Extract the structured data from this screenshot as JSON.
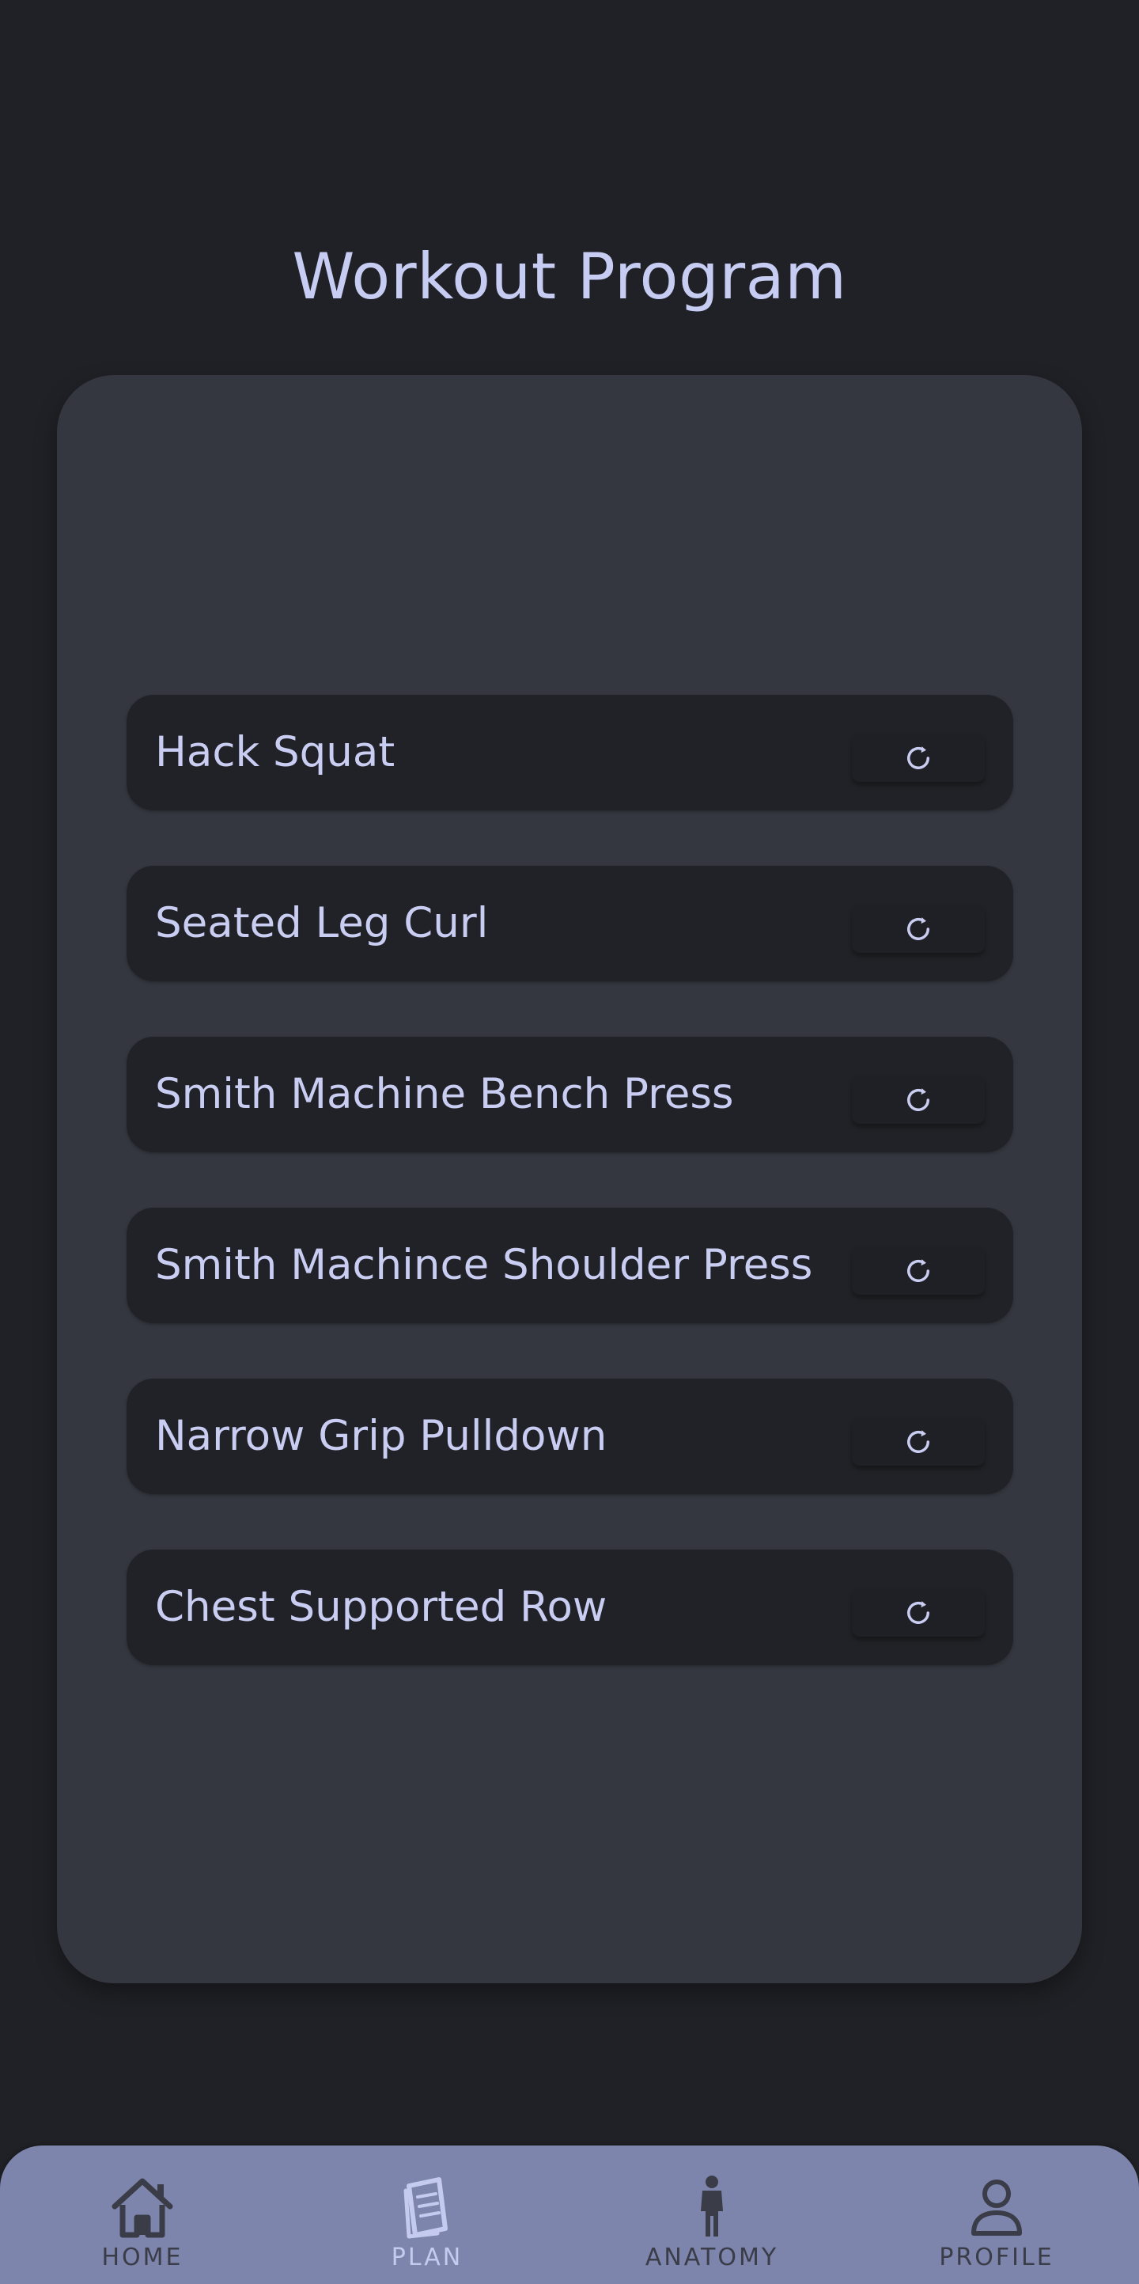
{
  "page": {
    "title": "Workout Program"
  },
  "exercises": [
    {
      "label": "Hack Squat",
      "reset_icon": "refresh-icon"
    },
    {
      "label": "Seated Leg Curl",
      "reset_icon": "refresh-icon"
    },
    {
      "label": "Smith Machine Bench Press",
      "reset_icon": "refresh-icon"
    },
    {
      "label": "Smith Machince Shoulder Press",
      "reset_icon": "refresh-icon"
    },
    {
      "label": "Narrow Grip Pulldown",
      "reset_icon": "refresh-icon"
    },
    {
      "label": "Chest Supported Row",
      "reset_icon": "refresh-icon"
    }
  ],
  "nav": {
    "active": "PLAN",
    "items": [
      {
        "label": "HOME",
        "icon": "home-icon"
      },
      {
        "label": "PLAN",
        "icon": "plan-document-icon"
      },
      {
        "label": "ANATOMY",
        "icon": "person-figure-icon"
      },
      {
        "label": "PROFILE",
        "icon": "profile-icon"
      }
    ]
  },
  "colors": {
    "background": "#202126",
    "card": "#353740",
    "row": "#212227",
    "text": "#c9cdf2",
    "nav_bar": "#7d85ad",
    "nav_inactive": "#3a3c47",
    "nav_active": "#c5cbef"
  }
}
